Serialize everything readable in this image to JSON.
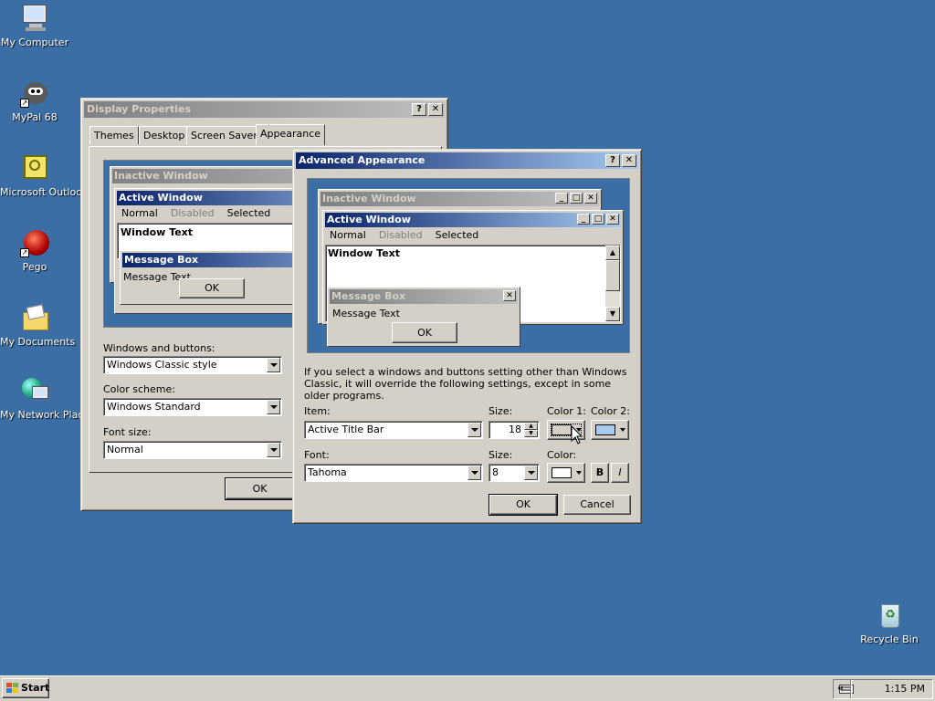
{
  "desktop": {
    "icons": [
      {
        "label": "My Computer",
        "icon": "computer-icon"
      },
      {
        "label": "MyPal 68",
        "icon": "mypal-browser-icon"
      },
      {
        "label": "Microsoft Outlook",
        "icon": "outlook-icon"
      },
      {
        "label": "Pego",
        "icon": "pego-icon"
      },
      {
        "label": "My Documents",
        "icon": "folder-documents-icon"
      },
      {
        "label": "My Network Places",
        "icon": "network-places-icon"
      },
      {
        "label": "Recycle Bin",
        "icon": "recycle-bin-icon"
      }
    ]
  },
  "display_properties": {
    "title": "Display Properties",
    "help_btn": "?",
    "close_btn": "✕",
    "tabs": [
      "Themes",
      "Desktop",
      "Screen Saver",
      "Appearance"
    ],
    "active_tab": "Appearance",
    "preview": {
      "inactive_title": "Inactive Window",
      "active_title": "Active Window",
      "menu": [
        "Normal",
        "Disabled",
        "Selected"
      ],
      "window_text": "Window Text",
      "msgbox_title": "Message Box",
      "msgbox_text": "Message Text",
      "ok": "OK"
    },
    "windows_buttons_label": "Windows and buttons:",
    "windows_buttons_value": "Windows Classic style",
    "color_scheme_label": "Color scheme:",
    "color_scheme_value": "Windows Standard",
    "font_size_label": "Font size:",
    "font_size_value": "Normal",
    "ok": "OK"
  },
  "advanced": {
    "title": "Advanced Appearance",
    "help_btn": "?",
    "close_btn": "✕",
    "preview": {
      "inactive_title": "Inactive Window",
      "active_title": "Active Window",
      "menu": [
        "Normal",
        "Disabled",
        "Selected"
      ],
      "window_text": "Window Text",
      "msgbox_title": "Message Box",
      "msgbox_text": "Message Text",
      "ok": "OK"
    },
    "note": "If you select a windows and buttons setting other than Windows Classic, it will override the following settings, except in some older programs.",
    "item_label": "Item:",
    "item_value": "Active Title Bar",
    "size_label": "Size:",
    "size_value": "18",
    "color1_label": "Color 1:",
    "color2_label": "Color 2:",
    "font_label": "Font:",
    "font_value": "Tahoma",
    "font_size_label": "Size:",
    "font_size_value": "8",
    "color_label": "Color:",
    "bold_btn": "B",
    "italic_btn": "I",
    "ok": "OK",
    "cancel": "Cancel"
  },
  "taskbar": {
    "start": "Start",
    "tray_toggle": "«",
    "time": "1:15 PM"
  },
  "colors": {
    "desktop": "#3a6ea5",
    "face": "#d4d0c8",
    "active_title_start": "#0a246a",
    "active_title_end": "#a6caf0",
    "color1_swatch": "#d4d0c8",
    "color2_swatch": "#a6caf0",
    "font_color_swatch": "#ffffff"
  }
}
